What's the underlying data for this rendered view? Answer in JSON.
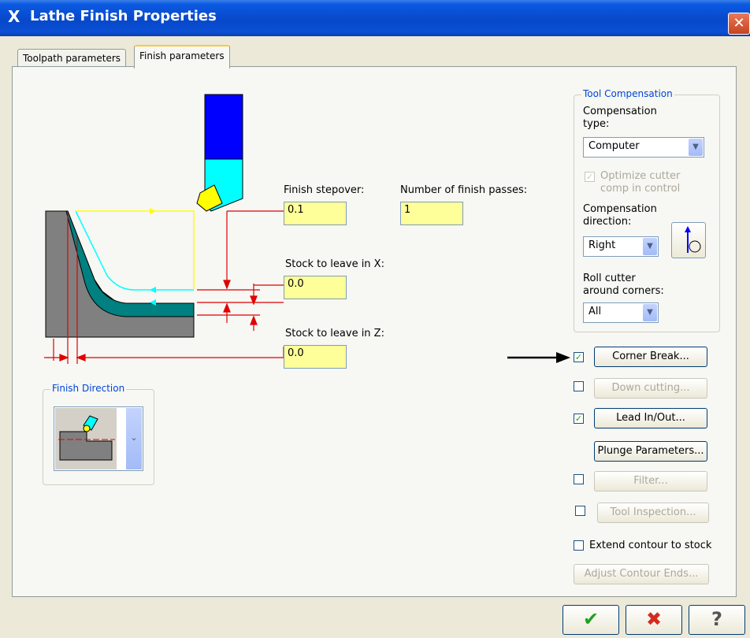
{
  "window": {
    "title": "Lathe Finish Properties",
    "close_glyph": "✕",
    "title_glyph": "X"
  },
  "tabs": [
    {
      "label": "Toolpath parameters",
      "active": false
    },
    {
      "label": "Finish parameters",
      "active": true
    }
  ],
  "fields": {
    "finish_stepover": {
      "label": "Finish stepover:",
      "value": "0.1"
    },
    "num_finish_passes": {
      "label": "Number of finish passes:",
      "value": "1"
    },
    "stock_x": {
      "label": "Stock to leave in X:",
      "value": "0.0"
    },
    "stock_z": {
      "label": "Stock to leave in Z:",
      "value": "0.0"
    }
  },
  "finish_direction": {
    "title": "Finish Direction"
  },
  "tool_comp": {
    "title": "Tool Compensation",
    "comp_type_label": "Compensation type:",
    "comp_type_value": "Computer",
    "optimize_label": "Optimize cutter comp in control",
    "comp_dir_label": "Compensation direction:",
    "comp_dir_value": "Right",
    "roll_label": "Roll cutter around corners:",
    "roll_value": "All"
  },
  "options": {
    "corner_break": {
      "label": "Corner Break...",
      "checked": true,
      "enabled": true
    },
    "down_cutting": {
      "label": "Down cutting...",
      "checked": false,
      "enabled": false
    },
    "lead_inout": {
      "label": "Lead In/Out...",
      "checked": true,
      "enabled": true
    },
    "plunge_params": {
      "label": "Plunge Parameters...",
      "enabled": true
    },
    "filter": {
      "label": "Filter...",
      "checked": false,
      "enabled": false
    },
    "tool_inspection": {
      "label": "Tool Inspection...",
      "checked": false,
      "enabled": false
    },
    "extend_contour": {
      "label": "Extend contour to stock",
      "checked": false
    },
    "adjust_contour_ends": {
      "label": "Adjust Contour Ends...",
      "enabled": false
    }
  },
  "footer": {
    "ok_glyph": "✔",
    "cancel_glyph": "✖",
    "help_glyph": "?"
  },
  "colors": {
    "input_bg": "#ffff99",
    "accent_blue": "#0046d5",
    "ok_green": "#21a121",
    "cancel_red": "#d42b1e"
  }
}
